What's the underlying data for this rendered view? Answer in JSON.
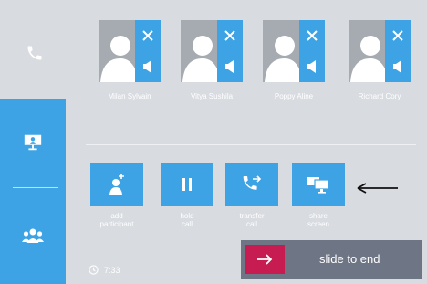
{
  "sidebar": {
    "items": [
      {
        "icon": "phone-icon"
      },
      {
        "icon": "video-conference-icon"
      },
      {
        "icon": "group-icon"
      }
    ]
  },
  "participants": [
    {
      "name": "Milan Sylvain"
    },
    {
      "name": "Vitya Sushila"
    },
    {
      "name": "Poppy Aline"
    },
    {
      "name": "Richard Cory"
    }
  ],
  "actions": [
    {
      "line1": "add",
      "line2": "participant",
      "icon": "add-person-icon"
    },
    {
      "line1": "hold",
      "line2": "call",
      "icon": "pause-icon"
    },
    {
      "line1": "transfer",
      "line2": "call",
      "icon": "phone-forward-icon"
    },
    {
      "line1": "share",
      "line2": "screen",
      "icon": "monitors-icon"
    }
  ],
  "call_timer": "7:33",
  "slide_to_end": {
    "label": "slide to end"
  },
  "colors": {
    "accent": "#3ea3e4",
    "background": "#d8dbe0",
    "end_call": "#c71c52",
    "slider_track": "#6e7584",
    "avatar_gray": "#a6abb1"
  }
}
